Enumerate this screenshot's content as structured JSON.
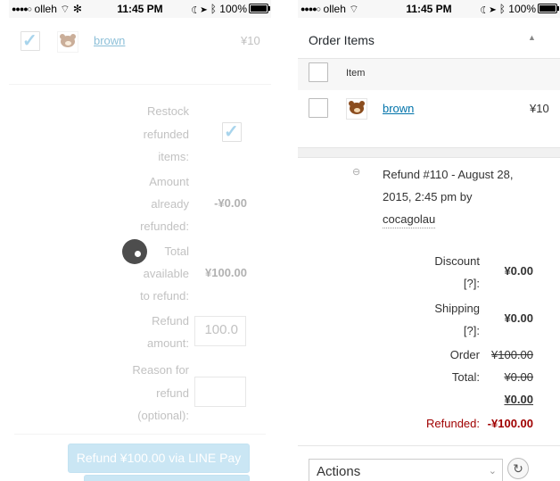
{
  "status_bar": {
    "carrier": "olleh",
    "time": "11:45 PM",
    "battery": "100%"
  },
  "left_screen": {
    "item_name": "brown",
    "item_price": "¥10",
    "restock_label": "Restock refunded items:",
    "already_refunded_label": "Amount already refunded:",
    "already_refunded_value": "-¥0.00",
    "total_available_label": "Total available to refund:",
    "total_available_value": "¥100.00",
    "refund_amount_label": "Refund amount:",
    "refund_amount_value": "100.0",
    "reason_label": "Reason for refund (optional):",
    "refund_button": "Refund ¥100.00 via LINE Pay"
  },
  "right_screen": {
    "panel_title": "Order Items",
    "column_item": "Item",
    "item_name": "brown",
    "item_price": "¥10",
    "refund_note_line1": "Refund #110 - August 28,",
    "refund_note_line2": "2015, 2:45 pm by",
    "refund_note_user": "cocagolau",
    "discount_label": "Discount",
    "discount_help": "[?]:",
    "discount_value": "¥0.00",
    "shipping_label": "Shipping",
    "shipping_help": "[?]:",
    "shipping_value": "¥0.00",
    "order_total_label1": "Order",
    "order_total_label2": "Total:",
    "order_total_old": "¥100.00",
    "order_total_mid": "¥0.00",
    "order_total_new": "¥0.00",
    "refunded_label": "Refunded:",
    "refunded_value": "-¥100.00",
    "actions_select": "Actions"
  },
  "colors": {
    "link": "#0073aa",
    "refunded": "#a00000",
    "button_blue": "#8cc8e8"
  }
}
